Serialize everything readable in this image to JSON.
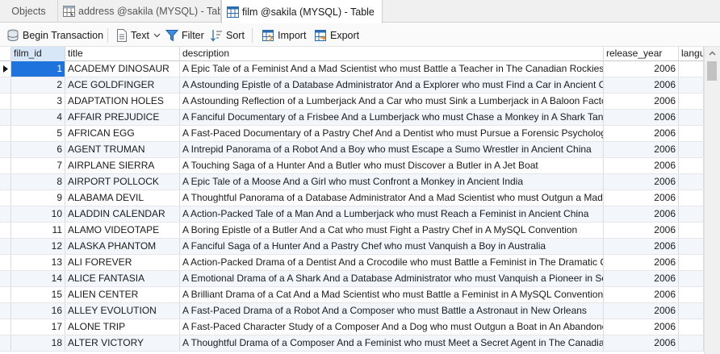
{
  "tabs": [
    {
      "label": "Objects"
    },
    {
      "label": "address @sakila (MYSQL) - Table"
    },
    {
      "label": "film @sakila (MYSQL) - Table"
    }
  ],
  "toolbar": {
    "begin_transaction": "Begin Transaction",
    "text": "Text",
    "filter": "Filter",
    "sort": "Sort",
    "import": "Import",
    "export": "Export"
  },
  "columns": {
    "film_id": "film_id",
    "title": "title",
    "description": "description",
    "release_year": "release_year",
    "language": "langu"
  },
  "rows": [
    {
      "film_id": "1",
      "title": "ACADEMY DINOSAUR",
      "description": "A Epic Tale of a Feminist And a Mad Scientist who must Battle a Teacher in The Canadian Rockies. Th",
      "release_year": "2006"
    },
    {
      "film_id": "2",
      "title": "ACE GOLDFINGER",
      "description": "A Astounding Epistle of a Database Administrator And a Explorer who must Find a Car in Ancient C",
      "release_year": "2006"
    },
    {
      "film_id": "3",
      "title": "ADAPTATION HOLES",
      "description": "A Astounding Reflection of a Lumberjack And a Car who must Sink a Lumberjack in A Baloon Facto",
      "release_year": "2006"
    },
    {
      "film_id": "4",
      "title": "AFFAIR PREJUDICE",
      "description": "A Fanciful Documentary of a Frisbee And a Lumberjack who must Chase a Monkey in A Shark Tank",
      "release_year": "2006"
    },
    {
      "film_id": "5",
      "title": "AFRICAN EGG",
      "description": "A Fast-Paced Documentary of a Pastry Chef And a Dentist who must Pursue a Forensic Psychologis",
      "release_year": "2006"
    },
    {
      "film_id": "6",
      "title": "AGENT TRUMAN",
      "description": "A Intrepid Panorama of a Robot And a Boy who must Escape a Sumo Wrestler in Ancient China",
      "release_year": "2006"
    },
    {
      "film_id": "7",
      "title": "AIRPLANE SIERRA",
      "description": "A Touching Saga of a Hunter And a Butler who must Discover a Butler in A Jet Boat",
      "release_year": "2006"
    },
    {
      "film_id": "8",
      "title": "AIRPORT POLLOCK",
      "description": "A Epic Tale of a Moose And a Girl who must Confront a Monkey in Ancient India",
      "release_year": "2006"
    },
    {
      "film_id": "9",
      "title": "ALABAMA DEVIL",
      "description": "A Thoughtful Panorama of a Database Administrator And a Mad Scientist who must Outgun a Mad",
      "release_year": "2006"
    },
    {
      "film_id": "10",
      "title": "ALADDIN CALENDAR",
      "description": "A Action-Packed Tale of a Man And a Lumberjack who must Reach a Feminist in Ancient China",
      "release_year": "2006"
    },
    {
      "film_id": "11",
      "title": "ALAMO VIDEOTAPE",
      "description": "A Boring Epistle of a Butler And a Cat who must Fight a Pastry Chef in A MySQL Convention",
      "release_year": "2006"
    },
    {
      "film_id": "12",
      "title": "ALASKA PHANTOM",
      "description": "A Fanciful Saga of a Hunter And a Pastry Chef who must Vanquish a Boy in Australia",
      "release_year": "2006"
    },
    {
      "film_id": "13",
      "title": "ALI FOREVER",
      "description": "A Action-Packed Drama of a Dentist And a Crocodile who must Battle a Feminist in The Dramatic C",
      "release_year": "2006"
    },
    {
      "film_id": "14",
      "title": "ALICE FANTASIA",
      "description": "A Emotional Drama of a A Shark And a Database Administrator who must Vanquish a Pioneer in Sov",
      "release_year": "2006"
    },
    {
      "film_id": "15",
      "title": "ALIEN CENTER",
      "description": "A Brilliant Drama of a Cat And a Mad Scientist who must Battle a Feminist in A MySQL Convention",
      "release_year": "2006"
    },
    {
      "film_id": "16",
      "title": "ALLEY EVOLUTION",
      "description": "A Fast-Paced Drama of a Robot And a Composer who must Battle a Astronaut in New Orleans",
      "release_year": "2006"
    },
    {
      "film_id": "17",
      "title": "ALONE TRIP",
      "description": "A Fast-Paced Character Study of a Composer And a Dog who must Outgun a Boat in An Abandone",
      "release_year": "2006"
    },
    {
      "film_id": "18",
      "title": "ALTER VICTORY",
      "description": "A Thoughtful Drama of a Composer And a Feminist who must Meet a Secret Agent in The Canadiar",
      "release_year": "2006"
    }
  ],
  "colors": {
    "selection": "#1e73dc",
    "header_selected": "#d8e7f7",
    "alt_row": "#f3f7fc"
  }
}
